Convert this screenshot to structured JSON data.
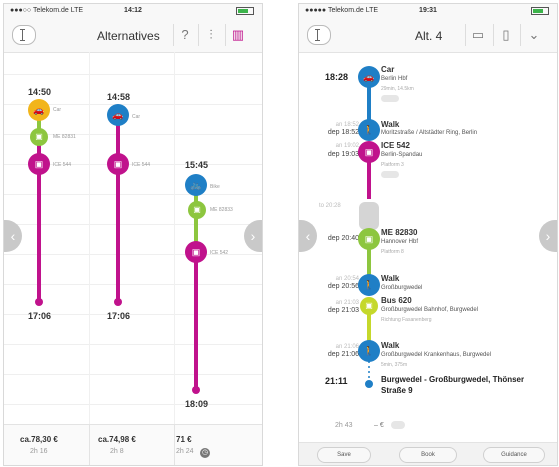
{
  "left": {
    "status": {
      "carrier": "●●●○○ Telekom.de LTE",
      "time": "14:12"
    },
    "title": "Alternatives",
    "icons": [
      "back-icon",
      "help-icon",
      "filter-icon",
      "color-legend-icon"
    ],
    "help_glyph": "?",
    "filter_glyph": "⫶",
    "legend_glyph": "▥",
    "arrow_left_glyph": "‹",
    "arrow_right_glyph": "›",
    "columns": [
      {
        "dep": "14:50",
        "arr": "17:06",
        "legs": [
          {
            "mode": "car",
            "label": "Car",
            "color": "#f2b51b"
          },
          {
            "mode": "regional-train",
            "label": "ME 82831",
            "color": "#8dc63f"
          },
          {
            "mode": "ice-train",
            "label": "ICE 544",
            "color": "#c0128c"
          }
        ]
      },
      {
        "dep": "14:58",
        "arr": "17:06",
        "legs": [
          {
            "mode": "car",
            "label": "Car",
            "color": "#1f7fc6"
          },
          {
            "mode": "ice-train",
            "label": "ICE 544",
            "color": "#c0128c"
          }
        ]
      },
      {
        "dep": "15:45",
        "arr": "18:09",
        "legs": [
          {
            "mode": "bike",
            "label": "Bike",
            "color": "#1f7fc6"
          },
          {
            "mode": "regional-train",
            "label": "ME 82833",
            "color": "#8dc63f"
          },
          {
            "mode": "ice-train",
            "label": "ICE 542",
            "color": "#c0128c"
          }
        ]
      }
    ],
    "footer": [
      {
        "price": "ca.78,30 €",
        "duration": "2h 16"
      },
      {
        "price": "ca.74,98 €",
        "duration": "2h 8"
      },
      {
        "price": "71 €",
        "duration": "2h 24"
      }
    ],
    "clock_glyph": "◷"
  },
  "right": {
    "status": {
      "carrier": "●●●●● Telekom.de LTE",
      "time": "19:31"
    },
    "title": "Alt. 4",
    "icons": [
      "back-icon",
      "chat-icon",
      "map-icon",
      "chevron-down-icon"
    ],
    "chat_glyph": "▭",
    "map_glyph": "▯",
    "chevron_glyph": "⌄",
    "arrow_left_glyph": "‹",
    "arrow_right_glyph": "›",
    "legs": [
      {
        "mode": "car",
        "title": "Car",
        "sub": "Berlin Hbf",
        "info": "29min, 14.5km",
        "time": "18:28",
        "color": "#1f7fc6"
      },
      {
        "mode": "walk",
        "title": "Walk",
        "sub": "Moritzstraße / Altstädter Ring, Berlin",
        "arr": "an 18:52",
        "dep": "dep 18:52",
        "color": "#1f7fc6"
      },
      {
        "mode": "ice-train",
        "title": "ICE 542",
        "sub": "Berlin-Spandau",
        "info": "Platform 3",
        "arr": "an 19:02",
        "dep": "dep 19:03",
        "color": "#c0128c"
      },
      {
        "mode": "regional-train",
        "title": "ME 82830",
        "sub": "Hannover Hbf",
        "info": "Platform 8",
        "arr": "an 20:28",
        "dep": "dep 20:40",
        "color": "#8dc63f"
      },
      {
        "mode": "walk",
        "title": "Walk",
        "sub": "Großburgwedel",
        "arr": "an 20:54",
        "dep": "dep 20:56",
        "color": "#1f7fc6"
      },
      {
        "mode": "bus",
        "title": "Bus 620",
        "sub": "Großburgwedel Bahnhof, Burgwedel",
        "info": "Richtung Fasanenberg",
        "arr": "an 21:03",
        "dep": "dep 21:03",
        "color": "#c5d82b"
      },
      {
        "mode": "walk",
        "title": "Walk",
        "sub": "Großburgwedel Krankenhaus, Burgwedel",
        "info": "5min, 375m",
        "arr": "an 21:06",
        "dep": "dep 21:06",
        "color": "#1f7fc6"
      }
    ],
    "gap_time": "to 20:28",
    "destination": {
      "time": "21:11",
      "name": "Burgwedel - Großburgwedel, Thönser Straße 9"
    },
    "summary": {
      "duration": "2h 43",
      "price": "– €"
    },
    "buttons": [
      "Save",
      "Book",
      "Guidance"
    ]
  },
  "colors": {
    "blue": "#1f7fc6",
    "magenta": "#c0128c",
    "green": "#8dc63f",
    "yellow": "#f2b51b",
    "lime": "#c5d82b"
  }
}
